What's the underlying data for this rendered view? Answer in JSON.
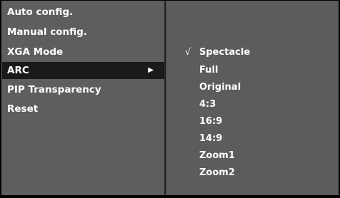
{
  "menu": {
    "items": [
      {
        "label": "Auto config."
      },
      {
        "label": "Manual config."
      },
      {
        "label": "XGA Mode"
      },
      {
        "label": "ARC",
        "selected": true,
        "has_submenu": true
      },
      {
        "label": "PIP Transparency"
      },
      {
        "label": "Reset"
      }
    ],
    "submenu_arrow_icon": "right-triangle-icon",
    "selected_bg": "#1a1a1a"
  },
  "submenu": {
    "check_mark": "√",
    "options": [
      {
        "label": "Spectacle",
        "checked": true
      },
      {
        "label": "Full"
      },
      {
        "label": "Original"
      },
      {
        "label": "4:3"
      },
      {
        "label": "16:9"
      },
      {
        "label": "14:9"
      },
      {
        "label": "Zoom1"
      },
      {
        "label": "Zoom2"
      }
    ]
  },
  "colors": {
    "panel_bg": "#5e5e5e",
    "frame_bg": "#000000",
    "text": "#ffffff"
  }
}
